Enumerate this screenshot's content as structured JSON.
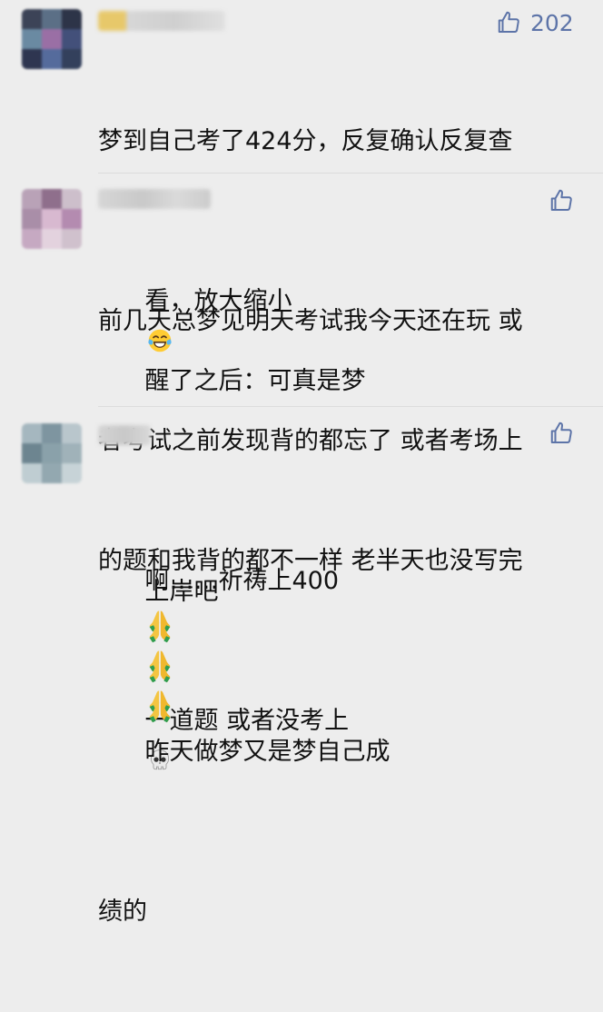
{
  "comments": [
    {
      "likes": "202",
      "lines": [
        "梦到自己考了424分，反复确认反复查",
        "看，放大缩小",
        "醒了之后：可真是梦",
        "啊……祈祷上400"
      ]
    },
    {
      "likes": "",
      "lines": [
        "前几天总梦见明天考试我今天还在玩 或",
        "者考试之前发现背的都忘了 或者考场上",
        "的题和我背的都不一样 老半天也没写完",
        "一道题 或者没考上"
      ]
    },
    {
      "likes": "",
      "lines": [
        "上岸吧",
        "昨天做梦又是梦自己成",
        "绩的"
      ]
    }
  ],
  "icons": {
    "like": "thumbs-up-icon",
    "laugh": "face-with-tears-of-joy-emoji",
    "pray": "folded-hands-emoji",
    "skull": "skull-emoji"
  },
  "colors": {
    "background": "#ededed",
    "text": "#111111",
    "like": "#5d74a8"
  }
}
